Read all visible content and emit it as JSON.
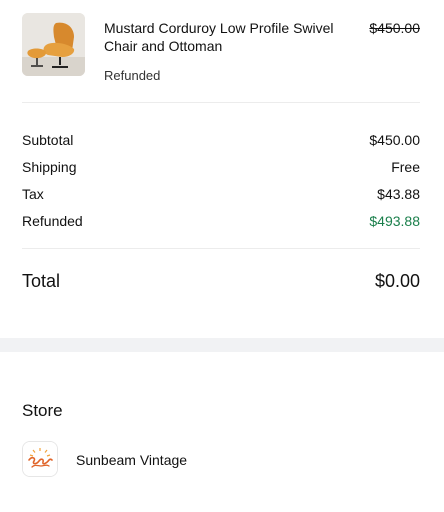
{
  "order": {
    "item": {
      "image_alt": "Mustard Corduroy Low Profile Swivel Chair and Ottoman",
      "name": "Mustard Corduroy Low Profile Swivel Chair and Ottoman",
      "status": "Refunded",
      "price": "$450.00",
      "price_struck": true
    },
    "summary": [
      {
        "label": "Subtotal",
        "value": "$450.00"
      },
      {
        "label": "Shipping",
        "value": "Free"
      },
      {
        "label": "Tax",
        "value": "$43.88"
      },
      {
        "label": "Refunded",
        "value": "$493.88",
        "color": "#1a7f4b"
      }
    ],
    "total": {
      "label": "Total",
      "value": "$0.00"
    }
  },
  "store": {
    "heading": "Store",
    "name": "Sunbeam Vintage",
    "logo_icon": "sunbeam-vintage-logo"
  }
}
